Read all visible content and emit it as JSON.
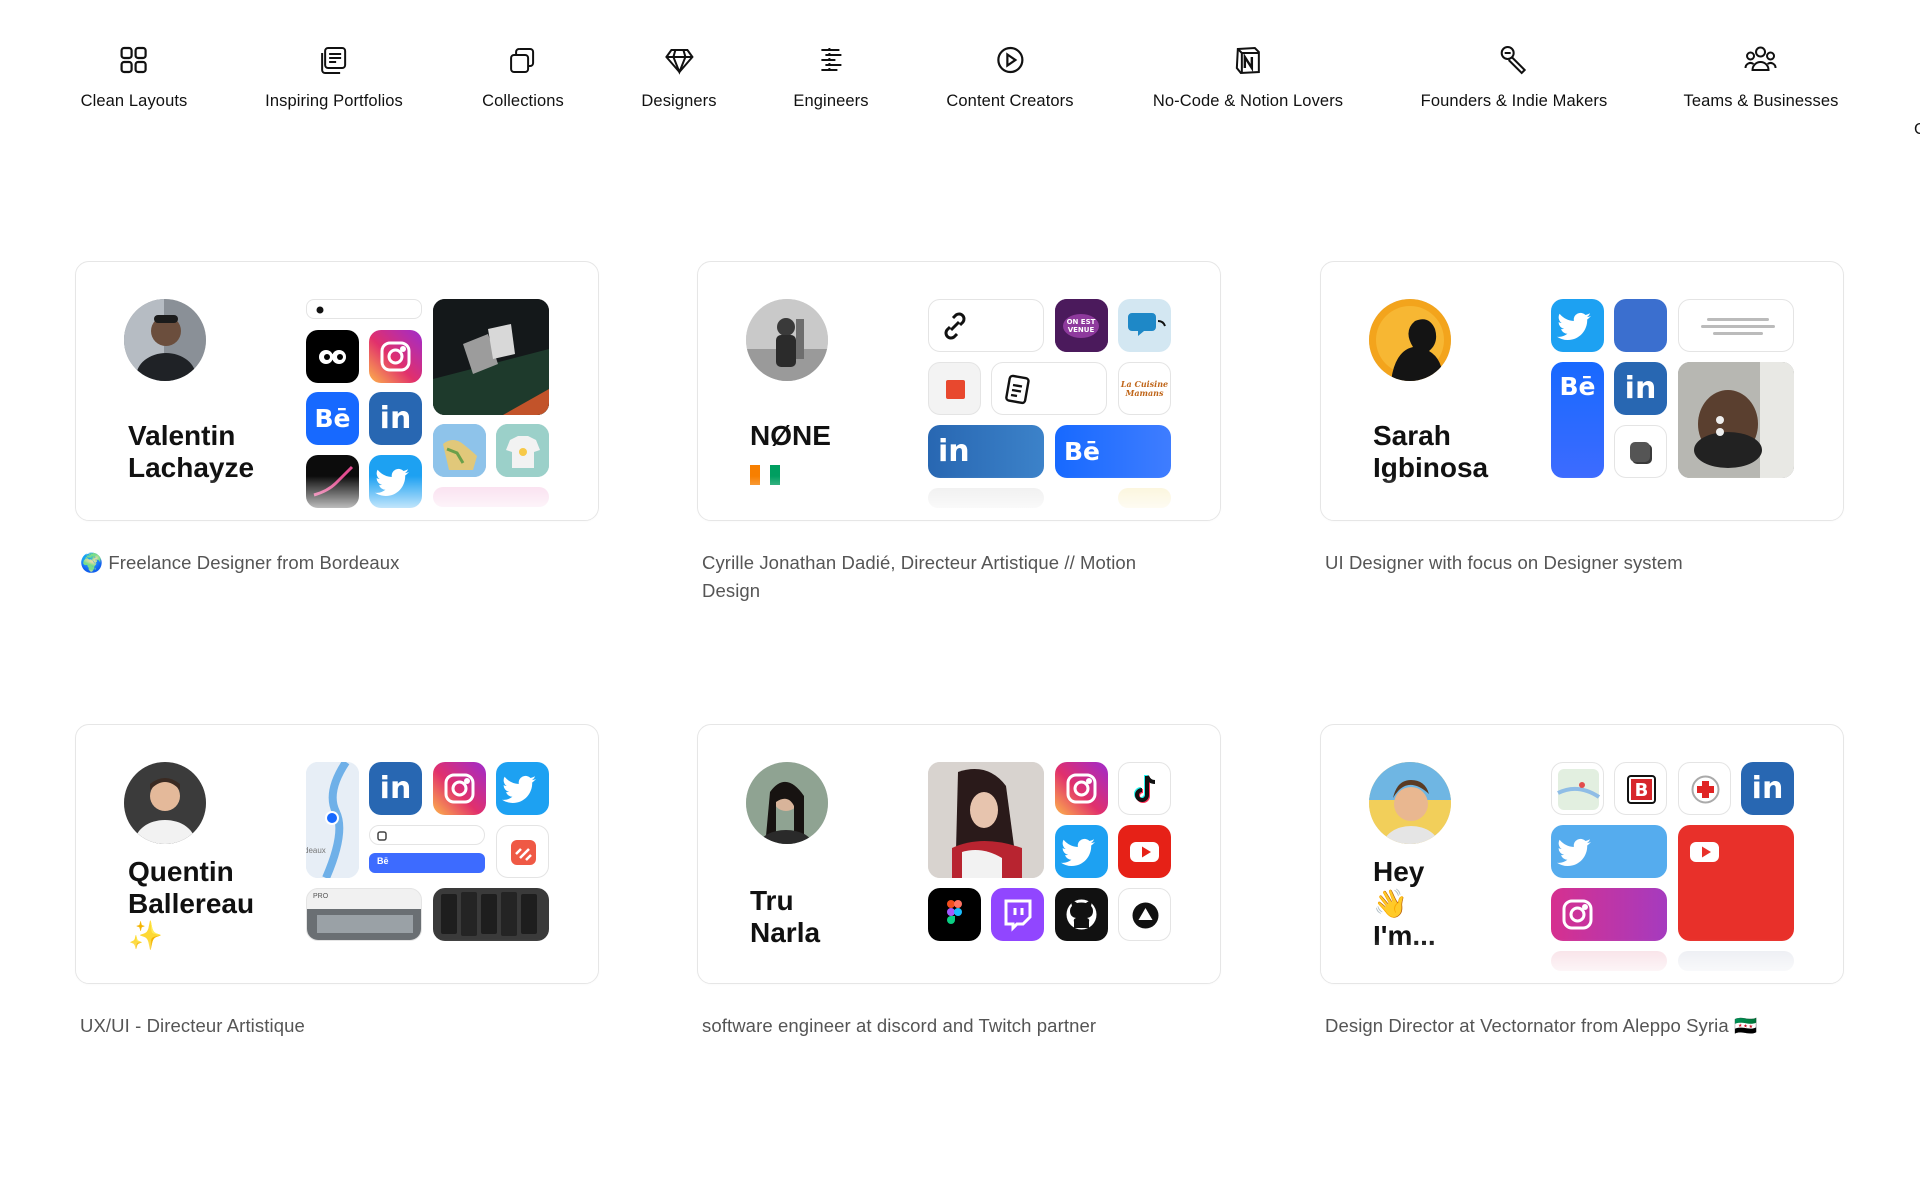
{
  "nav": {
    "items": [
      {
        "label": "Clean Layouts",
        "icon": "grid-icon"
      },
      {
        "label": "Inspiring Portfolios",
        "icon": "portfolio-icon"
      },
      {
        "label": "Collections",
        "icon": "collections-icon"
      },
      {
        "label": "Designers",
        "icon": "diamond-icon"
      },
      {
        "label": "Engineers",
        "icon": "code-icon"
      },
      {
        "label": "Content Creators",
        "icon": "play-icon"
      },
      {
        "label": "No-Code & Notion Lovers",
        "icon": "notion-icon"
      },
      {
        "label": "Founders & Indie Makers",
        "icon": "tools-icon"
      },
      {
        "label": "Teams & Businesses",
        "icon": "team-icon"
      }
    ],
    "overflow_fragment": "C"
  },
  "profiles": [
    {
      "name_line1": "Valentin",
      "name_line2": "Lachayze",
      "bio": "🌍 Freelance Designer from Bordeaux"
    },
    {
      "name_line1": "NØNE",
      "name_line2": "",
      "bio_line1": "Cyrille Jonathan Dadié, Directeur Artistique // Motion",
      "bio_line2": "Design"
    },
    {
      "name_line1": "Sarah",
      "name_line2": "Igbinosa",
      "bio": "UI Designer with focus on Designer system"
    },
    {
      "name_line1": "Quentin",
      "name_line2": "Ballereau",
      "name_line3": "✨",
      "bio": "UX/UI - Directeur Artistique"
    },
    {
      "name_line1": "Tru",
      "name_line2": "Narla",
      "bio": "software engineer at discord and Twitch partner"
    },
    {
      "name_line1": "Hey",
      "name_line2": "👋",
      "name_line3": "I'm...",
      "bio": "Design Director at Vectornator from Aleppo Syria 🇸🇾"
    }
  ],
  "tiles": {
    "behance": "Bē",
    "linkedin": "in",
    "mini_behance": "Bē",
    "map_fragment": "deaux",
    "tile_text": "PRO",
    "sticker": "ON EST VENUE",
    "script": "La Cuisine Mamans"
  },
  "colors": {
    "instagram": "#d6249f",
    "linkedin": "#2867b2",
    "twitter": "#1da1f2",
    "behance": "#1769ff",
    "youtube": "#e62117",
    "twitch": "#9146ff"
  }
}
